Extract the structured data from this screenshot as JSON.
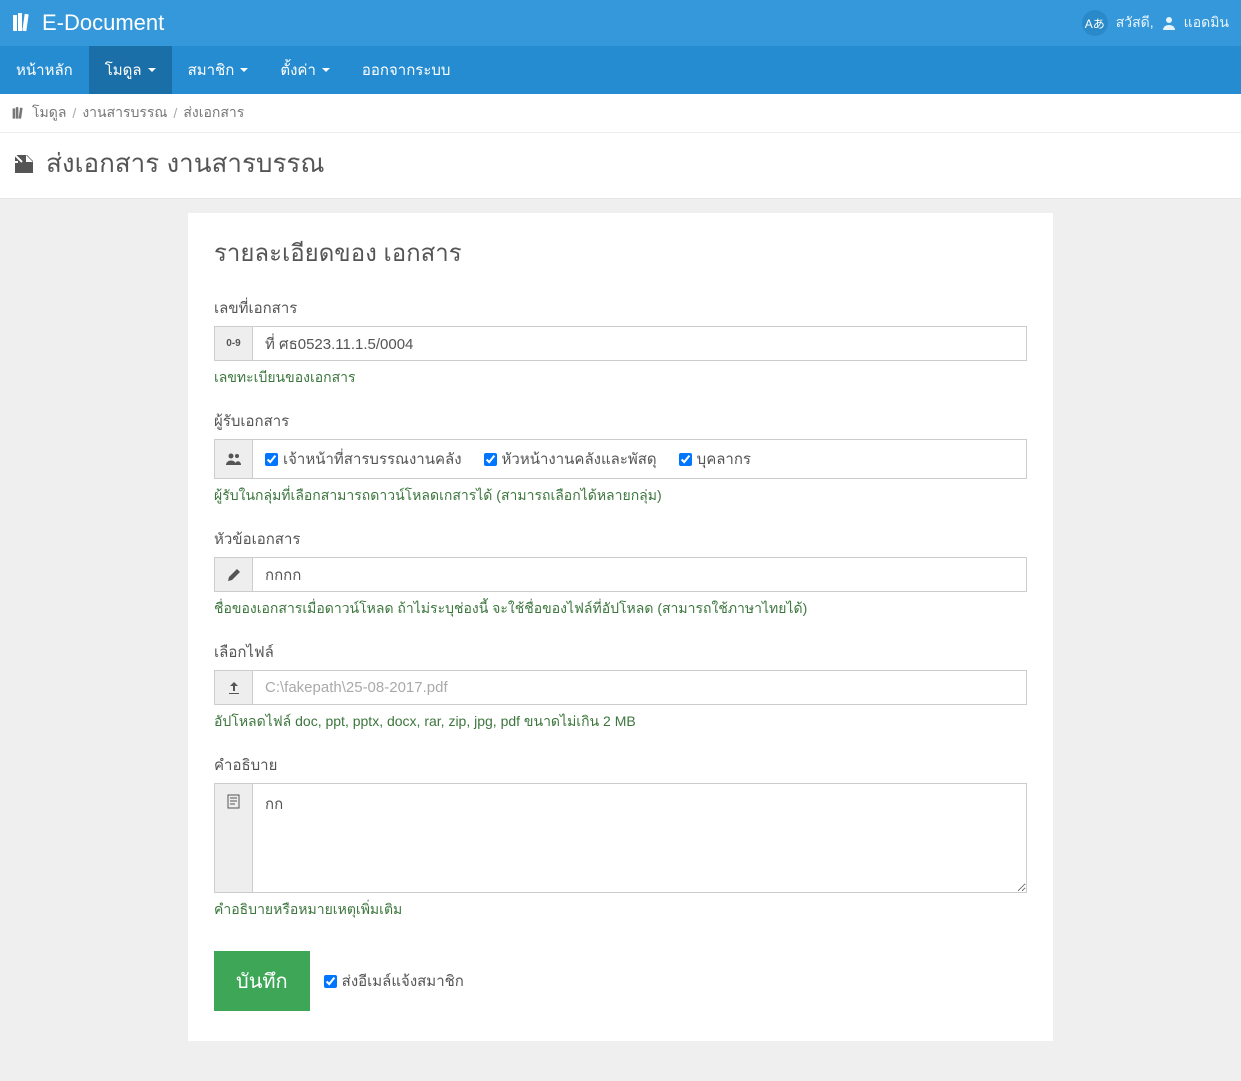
{
  "header": {
    "brand": "E-Document",
    "lang_badge": "Aあ",
    "greeting": "สวัสดี,",
    "username": "แอดมิน"
  },
  "nav": {
    "home": "หน้าหลัก",
    "module": "โมดูล",
    "member": "สมาชิก",
    "settings": "ตั้งค่า",
    "logout": "ออกจากระบบ"
  },
  "breadcrumb": {
    "item1": "โมดูล",
    "item2": "งานสารบรรณ",
    "item3": "ส่งเอกสาร"
  },
  "page": {
    "title": "ส่งเอกสาร งานสารบรรณ"
  },
  "panel": {
    "title": "รายละเอียดของ เอกสาร"
  },
  "form": {
    "doc_no": {
      "label": "เลขที่เอกสาร",
      "value": "ที่ ศธ0523.11.1.5/0004",
      "help": "เลขทะเบียนของเอกสาร"
    },
    "receiver": {
      "label": "ผู้รับเอกสาร",
      "opt1": "เจ้าหน้าที่สารบรรณงานคลัง",
      "opt2": "หัวหน้างานคลังและพัสดุ",
      "opt3": "บุคลากร",
      "help": "ผู้รับในกลุ่มที่เลือกสามารถดาวน์โหลดเกสารได้ (สามารถเลือกได้หลายกลุ่ม)"
    },
    "subject": {
      "label": "หัวข้อเอกสาร",
      "value": "กกกก",
      "help": "ชื่อของเอกสารเมื่อดาวน์โหลด ถ้าไม่ระบุช่องนี้ จะใช้ชื่อของไฟล์ที่อัปโหลด (สามารถใช้ภาษาไทยได้)"
    },
    "file": {
      "label": "เลือกไฟล์",
      "placeholder": "C:\\fakepath\\25-08-2017.pdf",
      "help": "อัปโหลดไฟล์ doc, ppt, pptx, docx, rar, zip, jpg, pdf ขนาดไม่เกิน 2 MB"
    },
    "description": {
      "label": "คำอธิบาย",
      "value": "กก",
      "help": "คำอธิบายหรือหมายเหตุเพิ่มเติม"
    },
    "submit": {
      "label": "บันทึก",
      "notify": "ส่งอีเมล์แจ้งสมาชิก"
    }
  }
}
